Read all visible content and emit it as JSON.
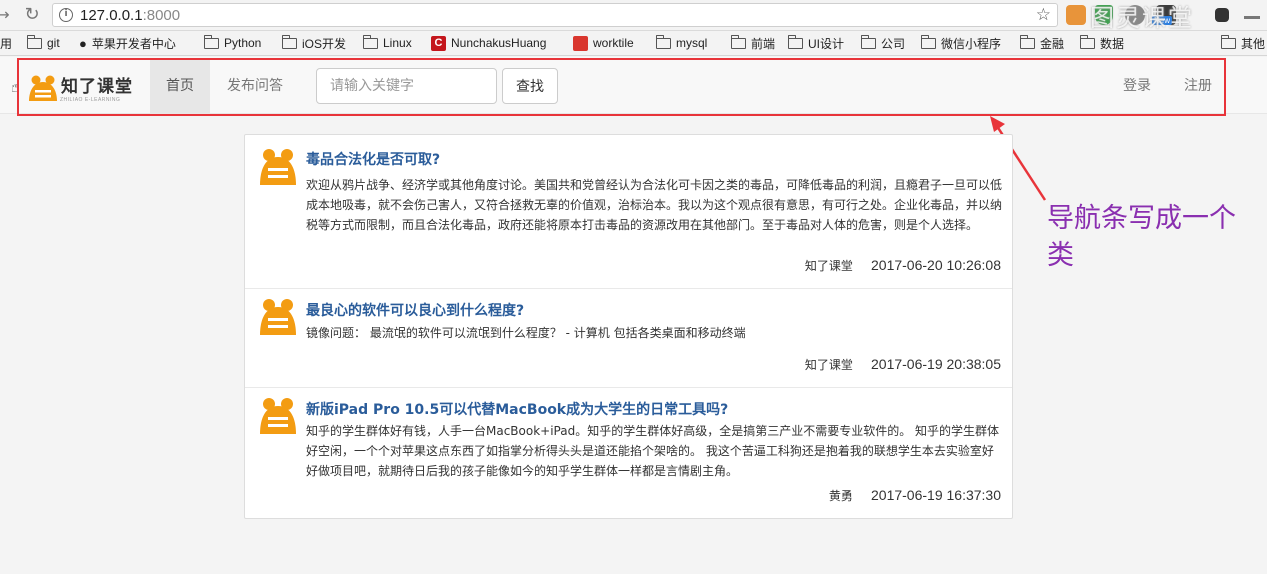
{
  "browser": {
    "url_host": "127.0.0.1",
    "url_port": ":8000",
    "ext_badge": "New",
    "watermark": "图灵课堂",
    "bookmarks": [
      {
        "label": "用",
        "icon": "none"
      },
      {
        "label": "git",
        "icon": "folder-icon"
      },
      {
        "label": "苹果开发者中心",
        "icon": "apple-icon"
      },
      {
        "label": "Python",
        "icon": "folder-icon"
      },
      {
        "label": "iOS开发",
        "icon": "folder-icon"
      },
      {
        "label": "Linux",
        "icon": "folder-icon"
      },
      {
        "label": "NunchakusHuang",
        "icon": "c-logo-icon"
      },
      {
        "label": "worktile",
        "icon": "worktile-icon"
      },
      {
        "label": "mysql",
        "icon": "folder-icon"
      },
      {
        "label": "前端",
        "icon": "folder-icon"
      },
      {
        "label": "UI设计",
        "icon": "folder-icon"
      },
      {
        "label": "公司",
        "icon": "folder-icon"
      },
      {
        "label": "微信小程序",
        "icon": "folder-icon"
      },
      {
        "label": "金融",
        "icon": "folder-icon"
      },
      {
        "label": "数据",
        "icon": "folder-icon"
      },
      {
        "label": "其他",
        "icon": "folder-icon"
      }
    ]
  },
  "navbar": {
    "logo_text": "知了课堂",
    "logo_sub": "ZHILIAO E-LEARNING",
    "home": "首页",
    "publish": "发布问答",
    "search_placeholder": "请输入关键字",
    "search_button": "查找",
    "login": "登录",
    "register": "注册"
  },
  "annotation": "导航条写成一个类",
  "questions": [
    {
      "title": "毒品合法化是否可取?",
      "body": "欢迎从鸦片战争、经济学或其他角度讨论。美国共和党曾经认为合法化可卡因之类的毒品，可降低毒品的利润，且瘾君子一旦可以低成本地吸毒，就不会伤己害人，又符合拯救无辜的价值观，治标治本。我以为这个观点很有意思，有可行之处。企业化毒品，并以纳税等方式而限制，而且合法化毒品，政府还能将原本打击毒品的资源改用在其他部门。至于毒品对人体的危害，则是个人选择。",
      "author": "知了课堂",
      "time": "2017-06-20 10:26:08"
    },
    {
      "title": "最良心的软件可以良心到什么程度?",
      "body": "镜像问题： 最流氓的软件可以流氓到什么程度？ - 计算机 包括各类桌面和移动终端",
      "author": "知了课堂",
      "time": "2017-06-19 20:38:05"
    },
    {
      "title": "新版iPad Pro 10.5可以代替MacBook成为大学生的日常工具吗?",
      "body": "知乎的学生群体好有钱，人手一台MacBook+iPad。知乎的学生群体好高级，全是搞第三产业不需要专业软件的。 知乎的学生群体好空闲，一个个对苹果这点东西了如指掌分析得头头是道还能掐个架啥的。 我这个苦逼工科狗还是抱着我的联想学生本去实验室好好做项目吧，就期待日后我的孩子能像如今的知乎学生群体一样都是言情剧主角。",
      "author": "黄勇",
      "time": "2017-06-19 16:37:30"
    }
  ],
  "colors": {
    "highlight": "#e8343a",
    "annotation": "#8a2fb0",
    "title_link": "#2a5c9a",
    "logo_orange": "#f39c12"
  }
}
